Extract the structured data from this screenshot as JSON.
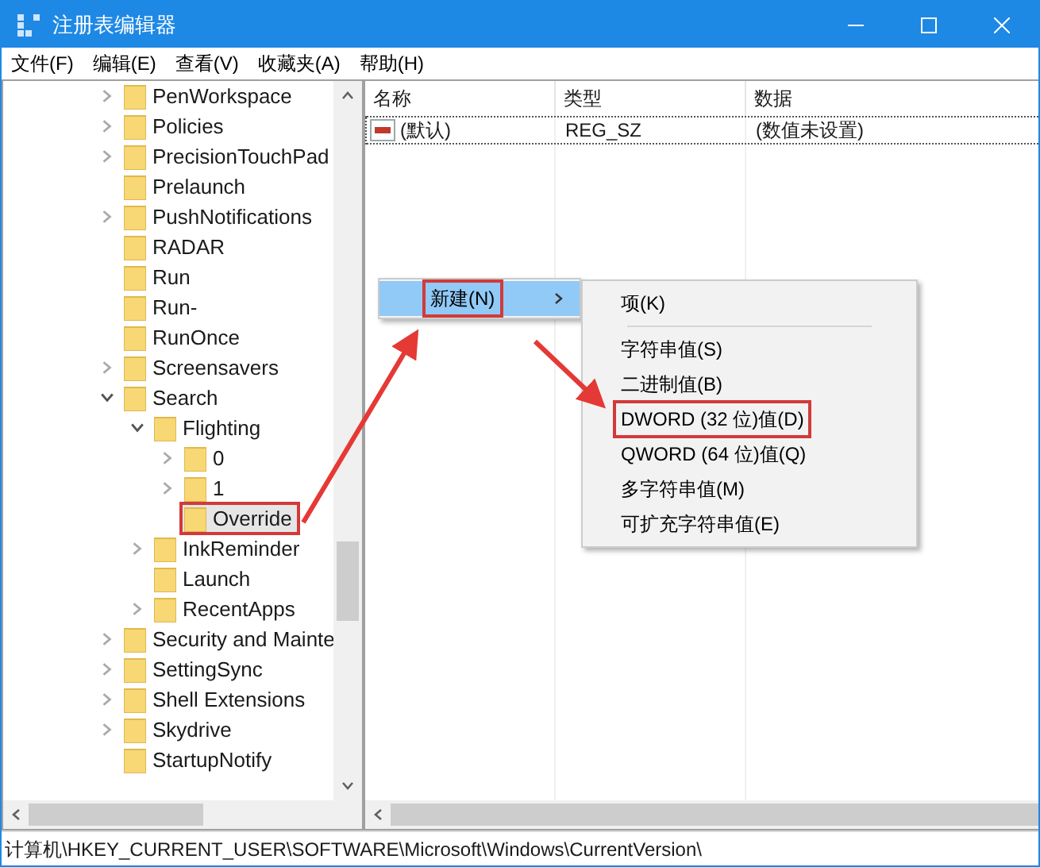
{
  "window": {
    "title": "注册表编辑器"
  },
  "menu_bar": [
    "文件(F)",
    "编辑(E)",
    "查看(V)",
    "收藏夹(A)",
    "帮助(H)"
  ],
  "tree": [
    {
      "name": "PenWorkspace",
      "expanded": false,
      "selected": false
    },
    {
      "name": "Policies",
      "expanded": false,
      "selected": false
    },
    {
      "name": "PrecisionTouchPad",
      "expanded": false,
      "selected": false
    },
    {
      "name": "Prelaunch",
      "selected": false
    },
    {
      "name": "PushNotifications",
      "expanded": false,
      "selected": false
    },
    {
      "name": "RADAR",
      "selected": false
    },
    {
      "name": "Run",
      "selected": false
    },
    {
      "name": "Run-",
      "selected": false
    },
    {
      "name": "RunOnce",
      "selected": false
    },
    {
      "name": "Screensavers",
      "expanded": false,
      "selected": false
    },
    {
      "name": "Search",
      "expanded": true,
      "selected": false,
      "children": [
        {
          "name": "Flighting",
          "expanded": true,
          "selected": false,
          "children": [
            {
              "name": "0",
              "expanded": false,
              "selected": false
            },
            {
              "name": "1",
              "expanded": false,
              "selected": false
            },
            {
              "name": "Override",
              "selected": true,
              "highlighted": true
            }
          ]
        },
        {
          "name": "InkReminder",
          "expanded": false,
          "selected": false
        },
        {
          "name": "Launch",
          "selected": false
        },
        {
          "name": "RecentApps",
          "expanded": false,
          "selected": false
        }
      ]
    },
    {
      "name": "Security and Mainte",
      "expanded": false,
      "selected": false
    },
    {
      "name": "SettingSync",
      "expanded": false,
      "selected": false
    },
    {
      "name": "Shell Extensions",
      "expanded": false,
      "selected": false
    },
    {
      "name": "Skydrive",
      "expanded": false,
      "selected": false
    },
    {
      "name": "StartupNotify",
      "selected": false
    }
  ],
  "values_table": {
    "columns": [
      "名称",
      "类型",
      "数据"
    ],
    "rows": [
      {
        "name": "(默认)",
        "type": "REG_SZ",
        "data": "(数值未设置)",
        "focused": true
      }
    ]
  },
  "context_menu": {
    "items": [
      {
        "label": "新建(N)",
        "selected": true,
        "highlighted": true,
        "has_submenu": true
      }
    ]
  },
  "submenu": {
    "groups": [
      [
        {
          "label": "项(K)",
          "highlighted": false
        }
      ],
      [
        {
          "label": "字符串值(S)",
          "highlighted": false
        },
        {
          "label": "二进制值(B)",
          "highlighted": false
        },
        {
          "label": "DWORD (32 位)值(D)",
          "highlighted": true
        },
        {
          "label": "QWORD (64 位)值(Q)",
          "highlighted": false
        },
        {
          "label": "多字符串值(M)",
          "highlighted": false
        },
        {
          "label": "可扩充字符串值(E)",
          "highlighted": false
        }
      ]
    ]
  },
  "status_bar": "计算机\\HKEY_CURRENT_USER\\SOFTWARE\\Microsoft\\Windows\\CurrentVersion\\"
}
